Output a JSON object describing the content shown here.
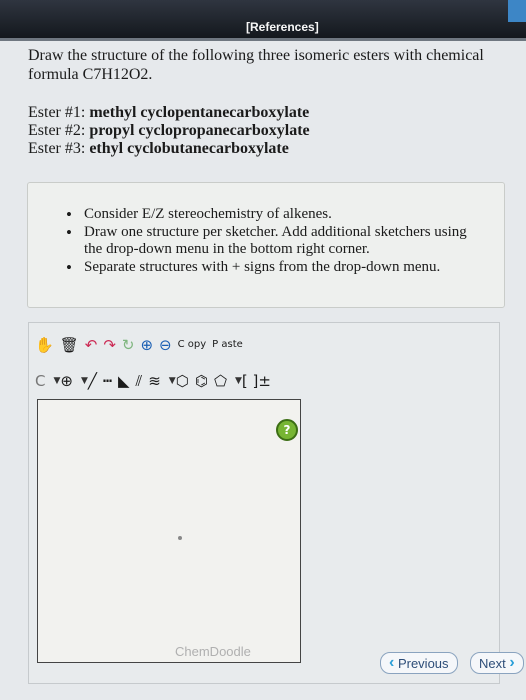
{
  "header": {
    "references": "[References]"
  },
  "prompt": {
    "line1": "Draw the structure of the following three isomeric esters with chemical",
    "line2": "formula C7H12O2."
  },
  "esters": [
    {
      "label": "Ester #1:",
      "name": "methyl cyclopentanecarboxylate"
    },
    {
      "label": "Ester #2:",
      "name": "propyl cyclopropanecarboxylate"
    },
    {
      "label": "Ester #3:",
      "name": "ethyl cyclobutanecarboxylate"
    }
  ],
  "instructions": [
    "Consider E/Z stereochemistry of alkenes.",
    "Draw one structure per sketcher. Add additional sketchers using the drop-down menu in the bottom right corner.",
    "Separate structures with + signs from the drop-down menu."
  ],
  "toolbar": {
    "copy": "C opy",
    "paste": "P aste",
    "carbon": "C",
    "charge": "[ ]±"
  },
  "help": "?",
  "footer": {
    "brand": "ChemDoodle",
    "previous": "Previous",
    "next": "Next"
  }
}
